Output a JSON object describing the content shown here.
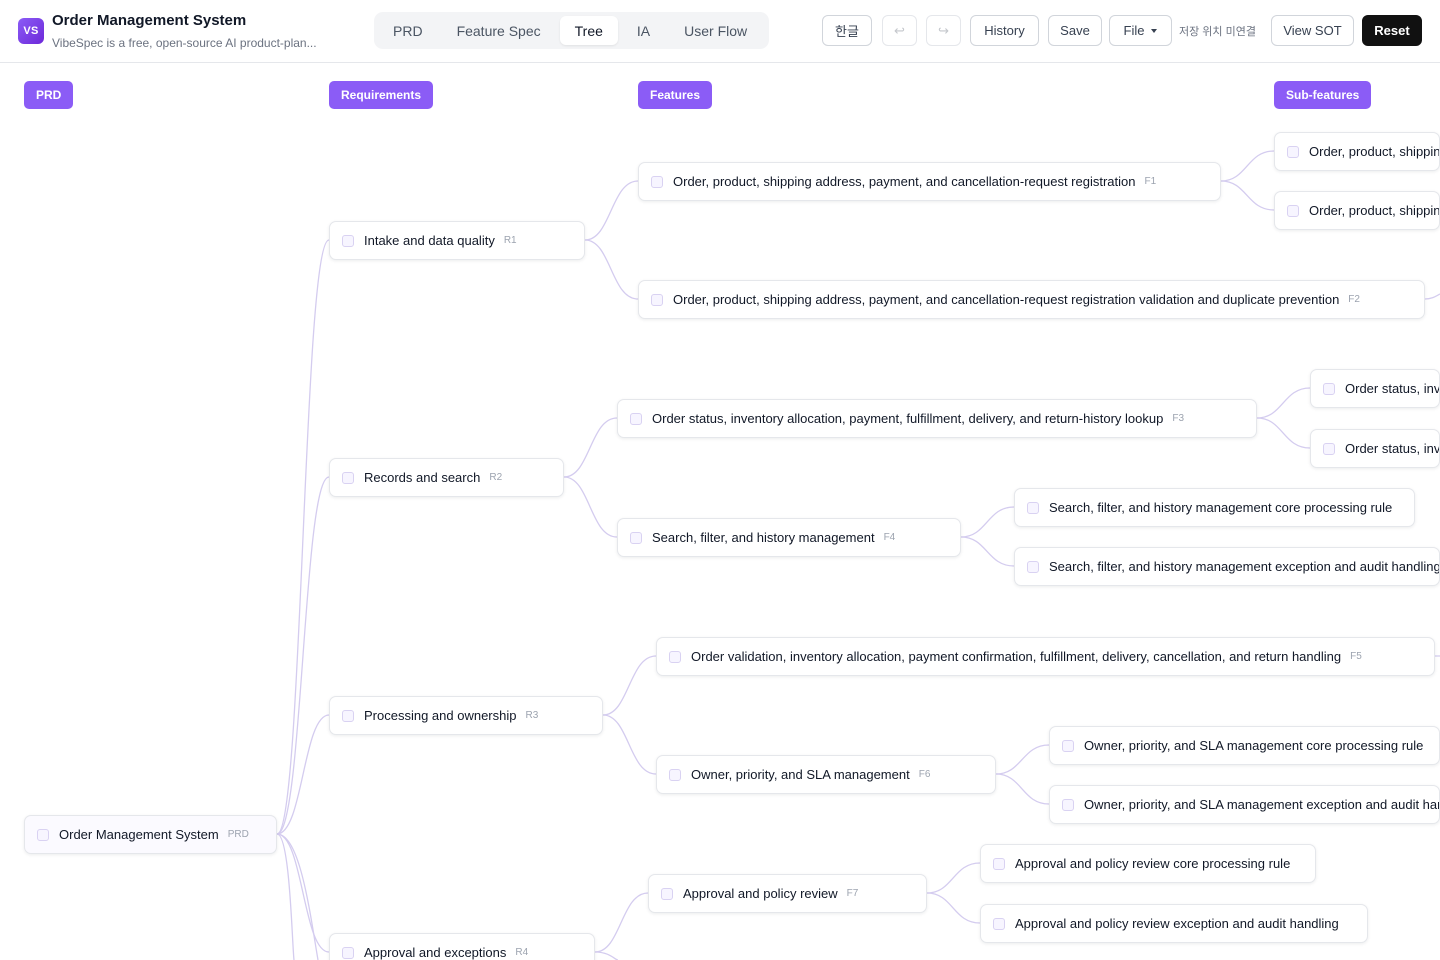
{
  "header": {
    "logo_text": "VS",
    "title": "Order Management System",
    "subtitle": "VibeSpec is a free, open-source AI product-plan...",
    "tabs": [
      "PRD",
      "Feature Spec",
      "Tree",
      "IA",
      "User Flow"
    ],
    "active_tab": "Tree",
    "lang_button": "한글",
    "undo_glyph": "↩",
    "redo_glyph": "↪",
    "history_label": "History",
    "save_label": "Save",
    "file_label": "File",
    "storage_status": "저장 위치 미연결",
    "view_sot_label": "View SOT",
    "reset_label": "Reset"
  },
  "columns": {
    "prd": "PRD",
    "requirements": "Requirements",
    "features": "Features",
    "subfeatures": "Sub-features"
  },
  "tree": {
    "root": {
      "label": "Order Management System",
      "code": "PRD"
    },
    "requirements": [
      {
        "label": "Intake and data quality",
        "code": "R1"
      },
      {
        "label": "Records and search",
        "code": "R2"
      },
      {
        "label": "Processing and ownership",
        "code": "R3"
      },
      {
        "label": "Approval and exceptions",
        "code": "R4"
      }
    ],
    "features": [
      {
        "label": "Order, product, shipping address, payment, and cancellation-request registration",
        "code": "F1"
      },
      {
        "label": "Order, product, shipping address, payment, and cancellation-request registration validation and duplicate prevention",
        "code": "F2"
      },
      {
        "label": "Order status, inventory allocation, payment, fulfillment, delivery, and return-history lookup",
        "code": "F3"
      },
      {
        "label": "Search, filter, and history management",
        "code": "F4"
      },
      {
        "label": "Order validation, inventory allocation, payment confirmation, fulfillment, delivery, cancellation, and return handling",
        "code": "F5"
      },
      {
        "label": "Owner, priority, and SLA management",
        "code": "F6"
      },
      {
        "label": "Approval and policy review",
        "code": "F7"
      }
    ],
    "subfeatures": [
      {
        "label": "Order, product, shippin"
      },
      {
        "label": "Order, product, shippin"
      },
      {
        "label": "Order status, inve"
      },
      {
        "label": "Order status, inve"
      },
      {
        "label": "Search, filter, and history management core processing rule"
      },
      {
        "label": "Search, filter, and history management exception and audit handling"
      },
      {
        "label": "Owner, priority, and SLA management core processing rule"
      },
      {
        "label": "Owner, priority, and SLA management exception and audit han"
      },
      {
        "label": "Approval and policy review core processing rule"
      },
      {
        "label": "Approval and policy review exception and audit handling"
      }
    ]
  }
}
